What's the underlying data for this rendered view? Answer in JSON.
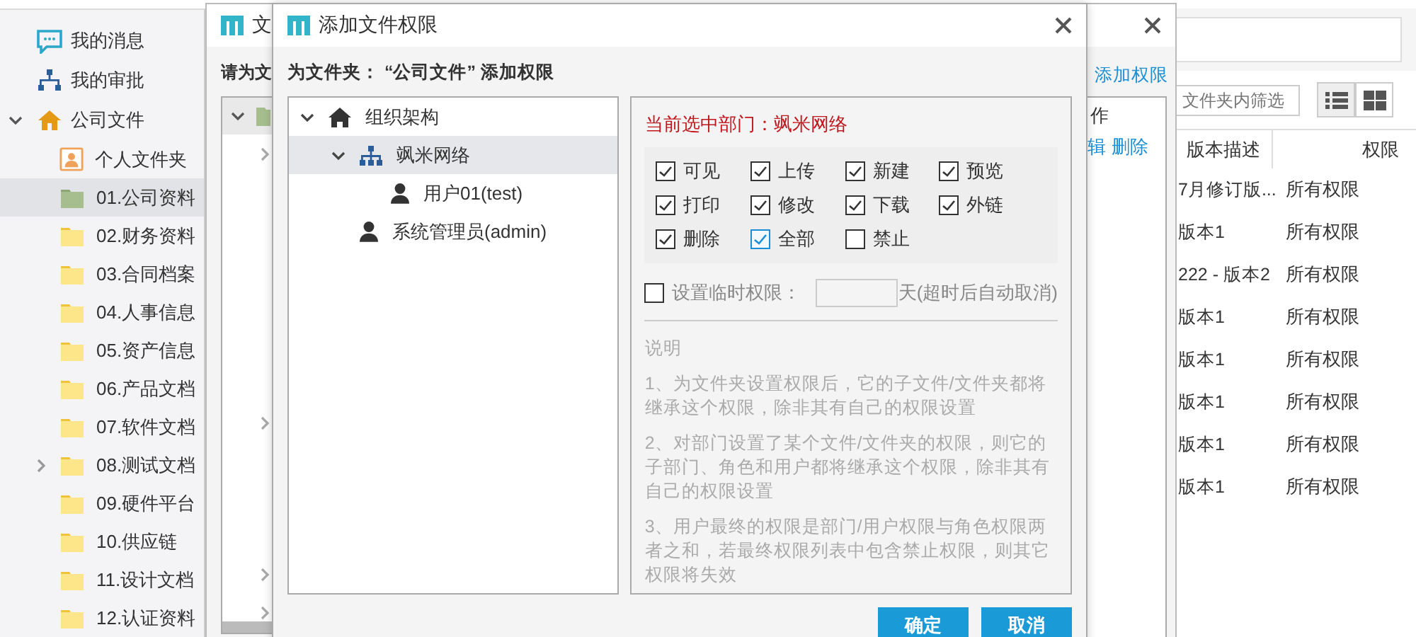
{
  "sidebar": {
    "items": [
      {
        "label": "我的消息",
        "kind": "messages"
      },
      {
        "label": "我的审批",
        "kind": "approvals"
      },
      {
        "label": "公司文件",
        "kind": "company",
        "expanded": true,
        "children": [
          {
            "label": "个人文件夹",
            "kind": "personal",
            "selected": false
          },
          {
            "label": "01.公司资料",
            "kind": "folder",
            "selected": true
          },
          {
            "label": "02.财务资料",
            "kind": "folder",
            "selected": false
          },
          {
            "label": "03.合同档案",
            "kind": "folder",
            "selected": false
          },
          {
            "label": "04.人事信息",
            "kind": "folder",
            "selected": false
          },
          {
            "label": "05.资产信息",
            "kind": "folder",
            "selected": false
          },
          {
            "label": "06.产品文档",
            "kind": "folder",
            "selected": false
          },
          {
            "label": "07.软件文档",
            "kind": "folder",
            "selected": false
          },
          {
            "label": "08.测试文档",
            "kind": "folder",
            "selected": false,
            "expanded": false
          },
          {
            "label": "09.硬件平台",
            "kind": "folder",
            "selected": false
          },
          {
            "label": "10.供应链",
            "kind": "folder",
            "selected": false
          },
          {
            "label": "11.设计文档",
            "kind": "folder",
            "selected": false
          },
          {
            "label": "12.认证资料",
            "kind": "folder",
            "selected": false
          }
        ]
      }
    ]
  },
  "main": {
    "filter": {
      "placeholder": "文件夹内筛选"
    },
    "view_toggle": [
      {
        "kind": "list",
        "selected": true
      },
      {
        "kind": "grid",
        "selected": false
      }
    ],
    "table": {
      "columns": [
        "版本描述",
        "权限"
      ],
      "rows": [
        [
          "7月修订版...",
          "所有权限"
        ],
        [
          "版本1",
          "所有权限"
        ],
        [
          "222 - 版本2",
          "所有权限"
        ],
        [
          "版本1",
          "所有权限"
        ],
        [
          "版本1",
          "所有权限"
        ],
        [
          "版本1",
          "所有权限"
        ],
        [
          "版本1",
          "所有权限"
        ],
        [
          "版本1",
          "所有权限"
        ]
      ]
    }
  },
  "back_dialog": {
    "title": "文",
    "prompt": "请为文",
    "add_link": "添加权限",
    "table": {
      "column": "作",
      "actions": [
        "辑",
        "删除"
      ]
    }
  },
  "dialog": {
    "title": "添加文件权限",
    "heading": "为文件夹： “公司文件” 添加权限",
    "org_tree": [
      {
        "label": "组织架构",
        "kind": "root",
        "expanded": true,
        "selected": false,
        "children": [
          {
            "label": "飒米网络",
            "kind": "department",
            "expanded": true,
            "selected": true,
            "children": [
              {
                "label": "用户01(test)",
                "kind": "user",
                "selected": false
              }
            ]
          },
          {
            "label": "系统管理员(admin)",
            "kind": "user",
            "selected": false
          }
        ]
      }
    ],
    "current": "当前选中部门：飒米网络",
    "permissions": [
      {
        "label": "可见",
        "checked": true,
        "focused": false
      },
      {
        "label": "上传",
        "checked": true,
        "focused": false
      },
      {
        "label": "新建",
        "checked": true,
        "focused": false
      },
      {
        "label": "预览",
        "checked": true,
        "focused": false
      },
      {
        "label": "打印",
        "checked": true,
        "focused": false
      },
      {
        "label": "修改",
        "checked": true,
        "focused": false
      },
      {
        "label": "下载",
        "checked": true,
        "focused": false
      },
      {
        "label": "外链",
        "checked": true,
        "focused": false
      },
      {
        "label": "删除",
        "checked": true,
        "focused": false
      },
      {
        "label": "全部",
        "checked": true,
        "focused": true
      },
      {
        "label": "禁止",
        "checked": false,
        "focused": false
      }
    ],
    "temp": {
      "checked": false,
      "label": "设置临时权限：",
      "suffix": "天(超时后自动取消)"
    },
    "notes": {
      "title": "说明",
      "paragraphs": [
        "1、为文件夹设置权限后，它的子文件/文件夹都将继承这个权限，除非其有自己的权限设置",
        "2、对部门设置了某个文件/文件夹的权限，则它的子部门、角色和用户都将继承这个权限，除非其有自己的权限设置",
        "3、用户最终的权限是部门/用户权限与角色权限两者之和，若最终权限列表中包含禁止权限，则其它权限将失效"
      ]
    },
    "buttons": [
      "确定",
      "取消"
    ]
  }
}
